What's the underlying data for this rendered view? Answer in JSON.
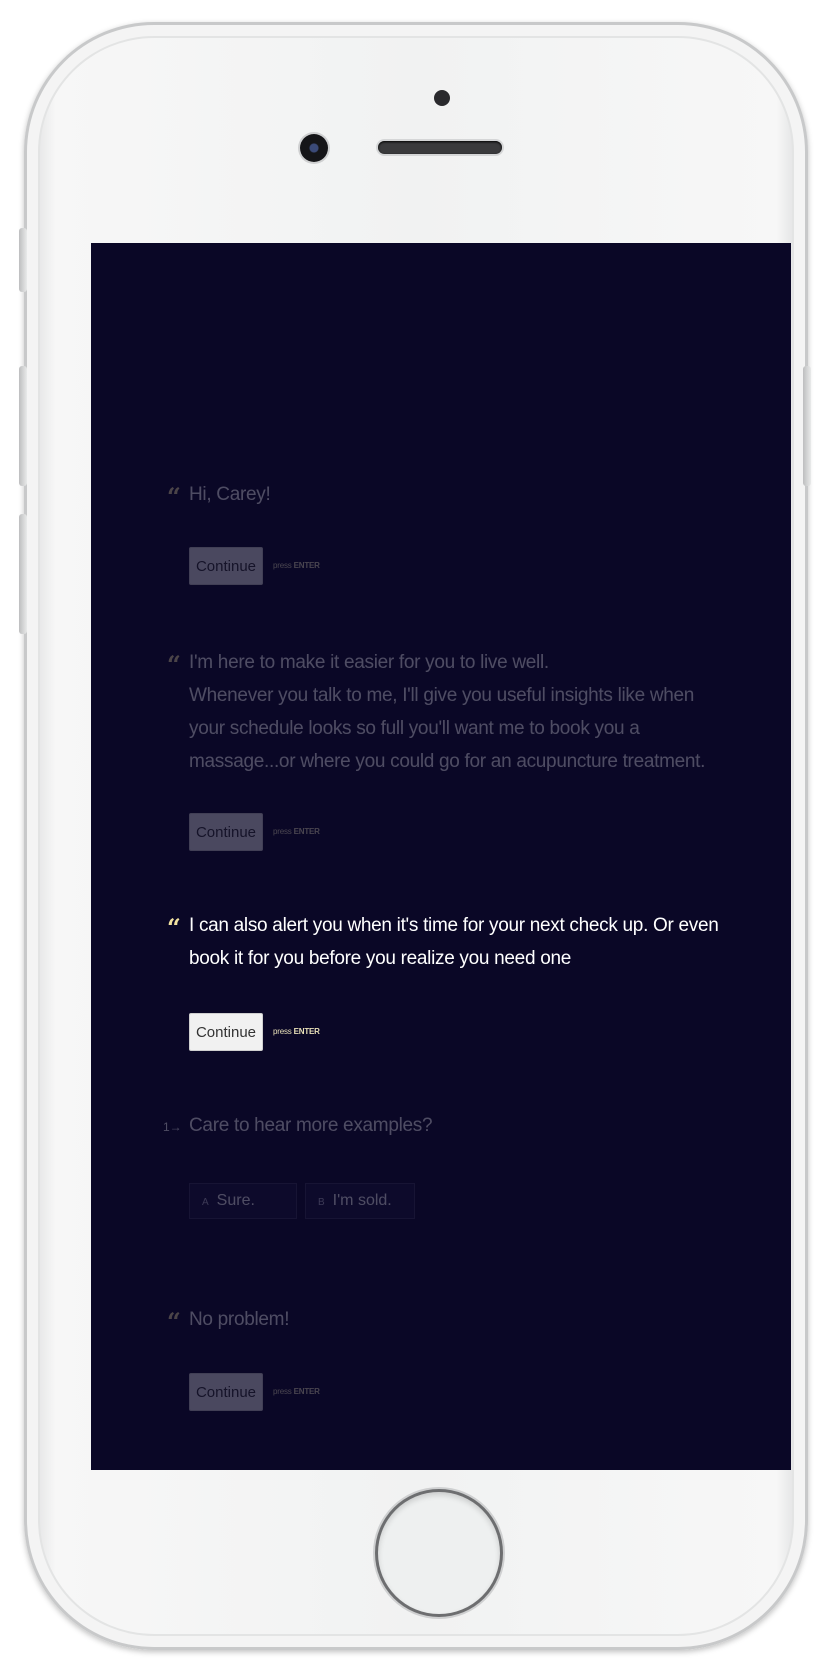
{
  "conversation": {
    "greeting": {
      "text": "Hi, Carey!",
      "button": "Continue",
      "hint_prefix": "press",
      "hint_key": "ENTER"
    },
    "intro": {
      "text": "I'm here to make it easier for you to live well.\nWhenever you talk to me, I'll give you useful insights like when your schedule looks so full you'll want me to book you a massage...or where you could go for an acupuncture treatment.",
      "button": "Continue",
      "hint_prefix": "press",
      "hint_key": "ENTER"
    },
    "alert": {
      "text": "I can also alert you when it's time for your next check up. Or even book it for you before you realize you need one",
      "button": "Continue",
      "hint_prefix": "press",
      "hint_key": "ENTER"
    },
    "question": {
      "number": "1→",
      "text": "Care to hear more examples?",
      "options": [
        {
          "key": "A",
          "label": "Sure."
        },
        {
          "key": "B",
          "label": "I'm sold."
        }
      ]
    },
    "closing": {
      "text": "No problem!",
      "button": "Continue",
      "hint_prefix": "press",
      "hint_key": "ENTER"
    }
  },
  "colors": {
    "screen_background": "#0a0726",
    "accent_quote": "#f2e2a0"
  }
}
